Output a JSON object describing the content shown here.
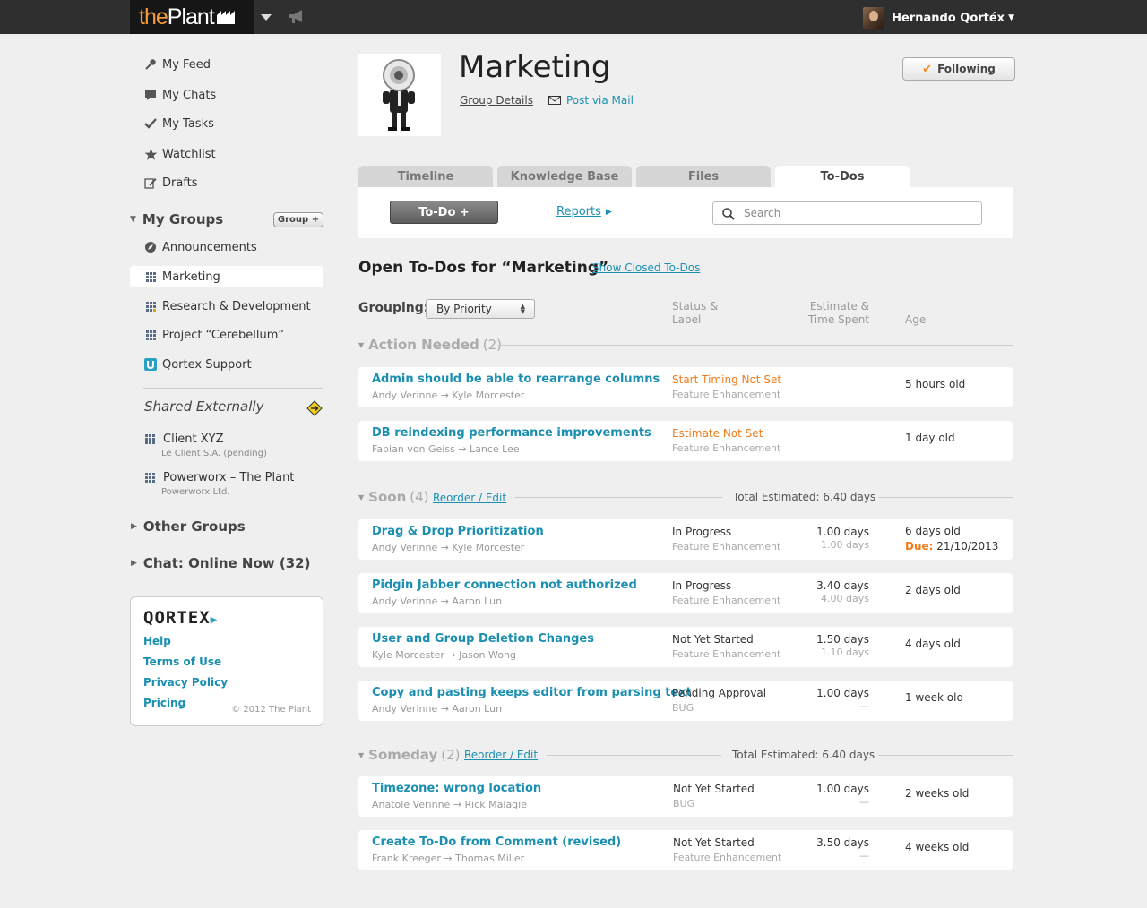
{
  "topbar": {
    "logo_the": "the",
    "logo_plant": "Plant",
    "user_name": "Hernando Qortéx"
  },
  "sidebar": {
    "nav": [
      {
        "label": "My Feed",
        "icon": "pin-icon"
      },
      {
        "label": "My Chats",
        "icon": "chat-bubble-icon"
      },
      {
        "label": "My Tasks",
        "icon": "check-icon"
      },
      {
        "label": "Watchlist",
        "icon": "star-icon"
      },
      {
        "label": "Drafts",
        "icon": "edit-icon"
      }
    ],
    "my_groups_title": "My Groups",
    "group_plus_label": "Group +",
    "groups": [
      {
        "label": "Announcements",
        "icon": "compass-icon"
      },
      {
        "label": "Marketing",
        "icon": "grid-icon"
      },
      {
        "label": "Research & Development",
        "icon": "grid-icon"
      },
      {
        "label": "Project “Cerebellum”",
        "icon": "grid-icon"
      },
      {
        "label": "Qortex Support",
        "icon": "support-icon"
      }
    ],
    "shared_title": "Shared Externally",
    "shared": [
      {
        "label": "Client XYZ",
        "sub": "Le Client S.A. (pending)"
      },
      {
        "label": "Powerworx – The Plant",
        "sub": "Powerworx Ltd."
      }
    ],
    "other_groups_title": "Other Groups",
    "chat_title": "Chat: Online Now (32)"
  },
  "footer": {
    "logo": "QORTEX",
    "links": [
      "Help",
      "Terms of Use",
      "Privacy Policy",
      "Pricing"
    ],
    "copyright": "© 2012 The Plant"
  },
  "header": {
    "title": "Marketing",
    "group_details": "Group Details",
    "post_via_mail": "Post via Mail",
    "following": "Following"
  },
  "tabs": [
    {
      "label": "Timeline"
    },
    {
      "label": "Knowledge Base"
    },
    {
      "label": "Files"
    },
    {
      "label": "To-Dos",
      "active": true
    }
  ],
  "toolbar": {
    "todo_button": "To-Do +",
    "reports": "Reports",
    "search_placeholder": "Search"
  },
  "content": {
    "open_title": "Open To-Dos for “Marketing”",
    "show_closed": "Show Closed To-Dos",
    "grouping_label": "Grouping:",
    "grouping_value": "By Priority",
    "col_status": [
      "Status &",
      "Label"
    ],
    "col_estimate": [
      "Estimate &",
      "Time Spent"
    ],
    "col_age": "Age"
  },
  "sections": [
    {
      "label": "Action Needed",
      "count": "(2)",
      "rows": [
        {
          "title": "Admin should be able to rearrange columns",
          "who": "Andy Verinne → Kyle Morcester",
          "status": "Start Timing Not Set",
          "label": "Feature Enhancement",
          "estimate": "",
          "spent": "",
          "age": "5 hours old"
        },
        {
          "title": "DB reindexing performance improvements",
          "who": "Fabian von Geiss → Lance Lee",
          "status": "Estimate Not Set",
          "label": "Feature Enhancement",
          "estimate": "",
          "spent": "",
          "age": "1 day old"
        }
      ]
    },
    {
      "label": "Soon",
      "count": "(4)",
      "reorder": "Reorder / Edit",
      "total": "Total Estimated: 6.40 days",
      "rows": [
        {
          "title": "Drag & Drop Prioritization",
          "who": "Andy Verinne → Kyle Morcester",
          "status": "In Progress",
          "label": "Feature Enhancement",
          "estimate": "1.00 days",
          "spent": "1.00 days",
          "age": "6 days old",
          "due_label": "Due:",
          "due_date": "21/10/2013"
        },
        {
          "title": "Pidgin Jabber connection not authorized",
          "who": "Andy Verinne → Aaron Lun",
          "status": "In Progress",
          "label": "Feature Enhancement",
          "estimate": "3.40 days",
          "spent": "4.00 days",
          "age": "2 days old"
        },
        {
          "title": "User and Group Deletion Changes",
          "who": "Kyle Morcester → Jason Wong",
          "status": "Not Yet Started",
          "label": "Feature Enhancement",
          "estimate": "1.50 days",
          "spent": "1.10 days",
          "age": "4 days old"
        },
        {
          "title": "Copy and pasting keeps editor from parsing text",
          "who": "Andy Verinne → Aaron Lun",
          "status": "Pending Approval",
          "label": "BUG",
          "estimate": "1.00 days",
          "spent": "—",
          "age": "1 week old"
        }
      ]
    },
    {
      "label": "Someday",
      "count": "(2)",
      "reorder": "Reorder / Edit",
      "total": "Total Estimated: 6.40 days",
      "rows": [
        {
          "title": "Timezone: wrong location",
          "who": "Anatole Verinne → Rick Malagie",
          "status": "Not Yet Started",
          "label": "BUG",
          "estimate": "1.00 days",
          "spent": "—",
          "age": "2 weeks old"
        },
        {
          "title": "Create To-Do from Comment (revised)",
          "who": "Frank Kreeger → Thomas Miller",
          "status": "Not Yet Started",
          "label": "Feature Enhancement",
          "estimate": "3.50 days",
          "spent": "—",
          "age": "4 weeks old"
        }
      ]
    }
  ],
  "colors": {
    "link": "#1b8fb1",
    "warn": "#f07c1c",
    "topbar": "#2f2f2f"
  }
}
